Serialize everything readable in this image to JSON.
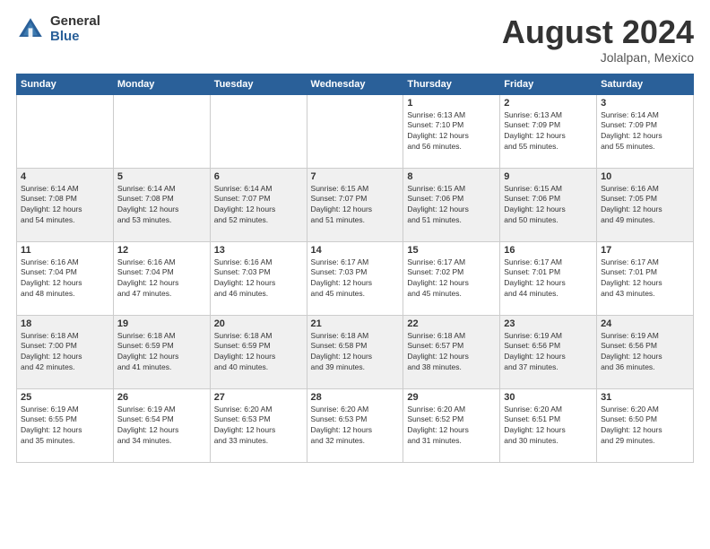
{
  "header": {
    "logo_general": "General",
    "logo_blue": "Blue",
    "main_title": "August 2024",
    "subtitle": "Jolalpan, Mexico"
  },
  "weekdays": [
    "Sunday",
    "Monday",
    "Tuesday",
    "Wednesday",
    "Thursday",
    "Friday",
    "Saturday"
  ],
  "weeks": [
    [
      {
        "day": "",
        "info": ""
      },
      {
        "day": "",
        "info": ""
      },
      {
        "day": "",
        "info": ""
      },
      {
        "day": "",
        "info": ""
      },
      {
        "day": "1",
        "info": "Sunrise: 6:13 AM\nSunset: 7:10 PM\nDaylight: 12 hours\nand 56 minutes."
      },
      {
        "day": "2",
        "info": "Sunrise: 6:13 AM\nSunset: 7:09 PM\nDaylight: 12 hours\nand 55 minutes."
      },
      {
        "day": "3",
        "info": "Sunrise: 6:14 AM\nSunset: 7:09 PM\nDaylight: 12 hours\nand 55 minutes."
      }
    ],
    [
      {
        "day": "4",
        "info": "Sunrise: 6:14 AM\nSunset: 7:08 PM\nDaylight: 12 hours\nand 54 minutes."
      },
      {
        "day": "5",
        "info": "Sunrise: 6:14 AM\nSunset: 7:08 PM\nDaylight: 12 hours\nand 53 minutes."
      },
      {
        "day": "6",
        "info": "Sunrise: 6:14 AM\nSunset: 7:07 PM\nDaylight: 12 hours\nand 52 minutes."
      },
      {
        "day": "7",
        "info": "Sunrise: 6:15 AM\nSunset: 7:07 PM\nDaylight: 12 hours\nand 51 minutes."
      },
      {
        "day": "8",
        "info": "Sunrise: 6:15 AM\nSunset: 7:06 PM\nDaylight: 12 hours\nand 51 minutes."
      },
      {
        "day": "9",
        "info": "Sunrise: 6:15 AM\nSunset: 7:06 PM\nDaylight: 12 hours\nand 50 minutes."
      },
      {
        "day": "10",
        "info": "Sunrise: 6:16 AM\nSunset: 7:05 PM\nDaylight: 12 hours\nand 49 minutes."
      }
    ],
    [
      {
        "day": "11",
        "info": "Sunrise: 6:16 AM\nSunset: 7:04 PM\nDaylight: 12 hours\nand 48 minutes."
      },
      {
        "day": "12",
        "info": "Sunrise: 6:16 AM\nSunset: 7:04 PM\nDaylight: 12 hours\nand 47 minutes."
      },
      {
        "day": "13",
        "info": "Sunrise: 6:16 AM\nSunset: 7:03 PM\nDaylight: 12 hours\nand 46 minutes."
      },
      {
        "day": "14",
        "info": "Sunrise: 6:17 AM\nSunset: 7:03 PM\nDaylight: 12 hours\nand 45 minutes."
      },
      {
        "day": "15",
        "info": "Sunrise: 6:17 AM\nSunset: 7:02 PM\nDaylight: 12 hours\nand 45 minutes."
      },
      {
        "day": "16",
        "info": "Sunrise: 6:17 AM\nSunset: 7:01 PM\nDaylight: 12 hours\nand 44 minutes."
      },
      {
        "day": "17",
        "info": "Sunrise: 6:17 AM\nSunset: 7:01 PM\nDaylight: 12 hours\nand 43 minutes."
      }
    ],
    [
      {
        "day": "18",
        "info": "Sunrise: 6:18 AM\nSunset: 7:00 PM\nDaylight: 12 hours\nand 42 minutes."
      },
      {
        "day": "19",
        "info": "Sunrise: 6:18 AM\nSunset: 6:59 PM\nDaylight: 12 hours\nand 41 minutes."
      },
      {
        "day": "20",
        "info": "Sunrise: 6:18 AM\nSunset: 6:59 PM\nDaylight: 12 hours\nand 40 minutes."
      },
      {
        "day": "21",
        "info": "Sunrise: 6:18 AM\nSunset: 6:58 PM\nDaylight: 12 hours\nand 39 minutes."
      },
      {
        "day": "22",
        "info": "Sunrise: 6:18 AM\nSunset: 6:57 PM\nDaylight: 12 hours\nand 38 minutes."
      },
      {
        "day": "23",
        "info": "Sunrise: 6:19 AM\nSunset: 6:56 PM\nDaylight: 12 hours\nand 37 minutes."
      },
      {
        "day": "24",
        "info": "Sunrise: 6:19 AM\nSunset: 6:56 PM\nDaylight: 12 hours\nand 36 minutes."
      }
    ],
    [
      {
        "day": "25",
        "info": "Sunrise: 6:19 AM\nSunset: 6:55 PM\nDaylight: 12 hours\nand 35 minutes."
      },
      {
        "day": "26",
        "info": "Sunrise: 6:19 AM\nSunset: 6:54 PM\nDaylight: 12 hours\nand 34 minutes."
      },
      {
        "day": "27",
        "info": "Sunrise: 6:20 AM\nSunset: 6:53 PM\nDaylight: 12 hours\nand 33 minutes."
      },
      {
        "day": "28",
        "info": "Sunrise: 6:20 AM\nSunset: 6:53 PM\nDaylight: 12 hours\nand 32 minutes."
      },
      {
        "day": "29",
        "info": "Sunrise: 6:20 AM\nSunset: 6:52 PM\nDaylight: 12 hours\nand 31 minutes."
      },
      {
        "day": "30",
        "info": "Sunrise: 6:20 AM\nSunset: 6:51 PM\nDaylight: 12 hours\nand 30 minutes."
      },
      {
        "day": "31",
        "info": "Sunrise: 6:20 AM\nSunset: 6:50 PM\nDaylight: 12 hours\nand 29 minutes."
      }
    ]
  ]
}
